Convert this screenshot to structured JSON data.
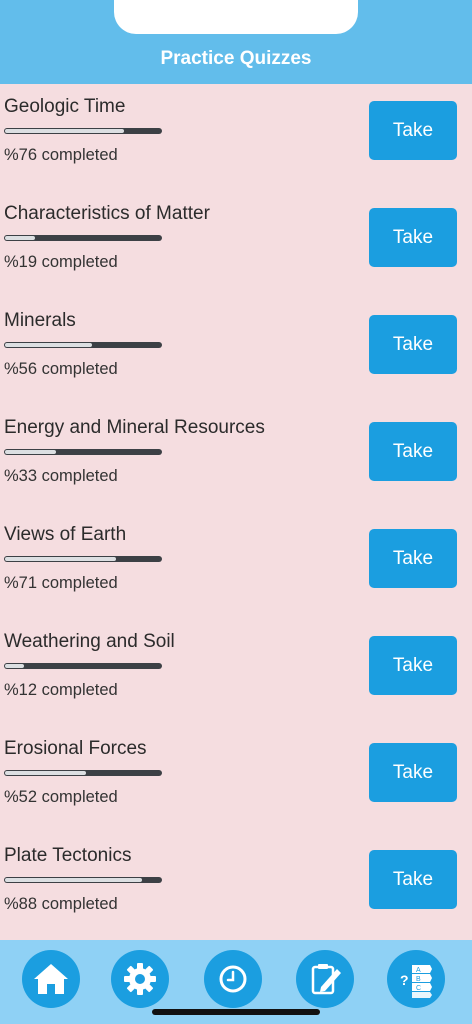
{
  "header": {
    "title": "Practice Quizzes"
  },
  "quizzes": [
    {
      "title": "Geologic Time",
      "progress": 0.76,
      "status": "%76 completed",
      "button": "Take"
    },
    {
      "title": "Characteristics of Matter",
      "progress": 0.19,
      "status": "%19 completed",
      "button": "Take"
    },
    {
      "title": "Minerals",
      "progress": 0.56,
      "status": "%56 completed",
      "button": "Take"
    },
    {
      "title": "Energy and Mineral Resources",
      "progress": 0.33,
      "status": "%33 completed",
      "button": "Take"
    },
    {
      "title": "Views of Earth",
      "progress": 0.71,
      "status": "%71 completed",
      "button": "Take"
    },
    {
      "title": "Weathering and Soil",
      "progress": 0.12,
      "status": "%12 completed",
      "button": "Take"
    },
    {
      "title": "Erosional Forces",
      "progress": 0.52,
      "status": "%52 completed",
      "button": "Take"
    },
    {
      "title": "Plate Tectonics",
      "progress": 0.88,
      "status": "%88 completed",
      "button": "Take"
    }
  ],
  "tabbar": {
    "tabs": [
      {
        "icon": "home-icon"
      },
      {
        "icon": "gear-icon"
      },
      {
        "icon": "clock-icon"
      },
      {
        "icon": "edit-note-icon"
      },
      {
        "icon": "quiz-list-icon"
      }
    ]
  },
  "colors": {
    "header": "#62bdeb",
    "background": "#f5dde0",
    "button": "#1b9ee0",
    "tabbar": "#8fd1f5"
  }
}
